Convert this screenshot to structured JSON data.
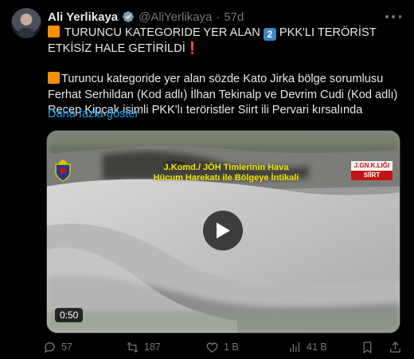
{
  "author": {
    "name": "Ali Yerlikaya",
    "handle": "@AliYerlikaya",
    "separator": "·",
    "time": "57d"
  },
  "tweet": {
    "line1_prefix": "TURUNCU KATEGORIDE YER ALAN",
    "line1_key": "2",
    "line1_suffix": "PKK'LI TERÖRİST ETKİSİZ HALE",
    "line2": "GETİRİLDİ",
    "body": "Turuncu kategoride yer alan sözde Kato Jirka bölge sorumlusu Ferhat Serhildan (Kod adlı) İlhan Tekinalp ve Devrim Cudi (Kod adlı) Recep Kipçak isimli PKK'lı teröristler Siirt ili Pervari kırsalında",
    "show_more": "Daha fazla göster"
  },
  "video": {
    "overlay_line1": "J.Komd./ JÖH Timlerinin Hava",
    "overlay_line2": "Hücum Harekatı ile Bölgeye İntikali",
    "badge_top": "J.GN.K.LIĞI",
    "badge_bottom": "SİİRT",
    "duration": "0:50"
  },
  "actions": {
    "replies": "57",
    "reposts": "187",
    "likes": "1 B",
    "views": "41 B"
  },
  "colors": {
    "accent": "#1d9bf0",
    "text": "#e7e9ea",
    "muted": "#71767b",
    "background": "#000000",
    "orange_square": "#f4900c",
    "overlay_yellow": "#f2e400"
  }
}
